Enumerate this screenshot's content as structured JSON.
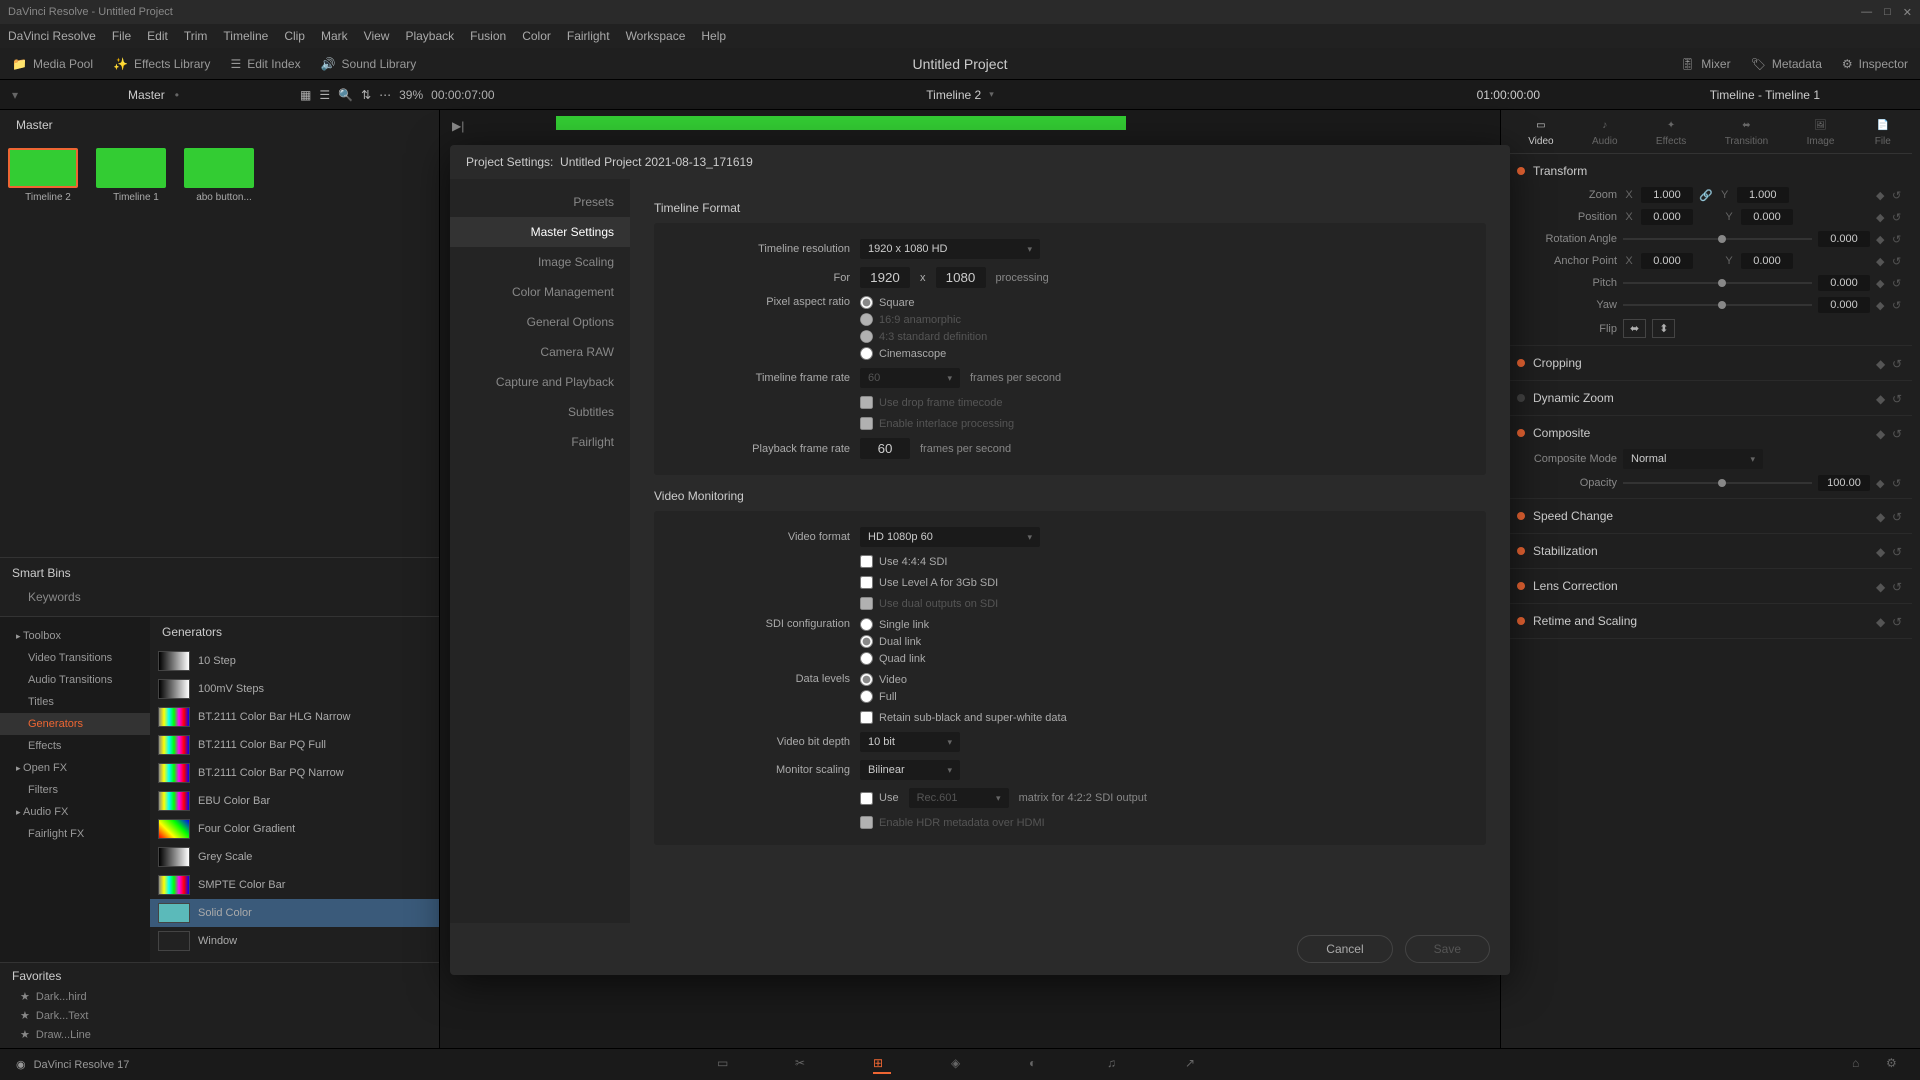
{
  "titlebar": {
    "title": "DaVinci Resolve - Untitled Project"
  },
  "menubar": [
    "DaVinci Resolve",
    "File",
    "Edit",
    "Trim",
    "Timeline",
    "Clip",
    "Mark",
    "View",
    "Playback",
    "Fusion",
    "Color",
    "Fairlight",
    "Workspace",
    "Help"
  ],
  "toolbar": {
    "media_pool": "Media Pool",
    "effects_library": "Effects Library",
    "edit_index": "Edit Index",
    "sound_library": "Sound Library",
    "project_title": "Untitled Project",
    "mixer": "Mixer",
    "metadata": "Metadata",
    "inspector": "Inspector"
  },
  "secondary": {
    "master": "Master",
    "zoom_pct": "39%",
    "timecode_left": "00:00:07:00",
    "timeline_name": "Timeline 2",
    "timecode_right": "01:00:00:00",
    "timeline_label": "Timeline - Timeline 1"
  },
  "left": {
    "master_tab": "Master",
    "clips": [
      {
        "label": "Timeline 2",
        "selected": true
      },
      {
        "label": "Timeline 1",
        "selected": false
      },
      {
        "label": "abo button...",
        "selected": false
      }
    ],
    "smart_bins": {
      "header": "Smart Bins",
      "items": [
        "Keywords"
      ]
    },
    "toolbox": {
      "items": [
        {
          "label": "Toolbox",
          "expandable": true
        },
        {
          "label": "Video Transitions",
          "child": true
        },
        {
          "label": "Audio Transitions",
          "child": true
        },
        {
          "label": "Titles",
          "child": true
        },
        {
          "label": "Generators",
          "child": true,
          "selected": true
        },
        {
          "label": "Effects",
          "child": true
        },
        {
          "label": "Open FX",
          "expandable": true
        },
        {
          "label": "Filters",
          "child": true
        },
        {
          "label": "Audio FX",
          "expandable": true
        },
        {
          "label": "Fairlight FX",
          "child": true
        }
      ]
    },
    "generators": {
      "header": "Generators",
      "items": [
        {
          "name": "10 Step",
          "swatch": "linear-gradient(90deg,#000,#fff)"
        },
        {
          "name": "100mV Steps",
          "swatch": "linear-gradient(90deg,#000,#fff)"
        },
        {
          "name": "BT.2111 Color Bar HLG Narrow",
          "swatch": "linear-gradient(90deg,#888,#ff0,#0ff,#0f0,#f0f,#f00,#00f)"
        },
        {
          "name": "BT.2111 Color Bar PQ Full",
          "swatch": "linear-gradient(90deg,#888,#ff0,#0ff,#0f0,#f0f,#f00,#00f)"
        },
        {
          "name": "BT.2111 Color Bar PQ Narrow",
          "swatch": "linear-gradient(90deg,#888,#ff0,#0ff,#0f0,#f0f,#f00,#00f)"
        },
        {
          "name": "EBU Color Bar",
          "swatch": "linear-gradient(90deg,#888,#ff0,#0ff,#0f0,#f0f,#f00,#00f)"
        },
        {
          "name": "Four Color Gradient",
          "swatch": "linear-gradient(45deg,#f00,#ff0,#0f0,#00f)"
        },
        {
          "name": "Grey Scale",
          "swatch": "linear-gradient(90deg,#000,#fff)"
        },
        {
          "name": "SMPTE Color Bar",
          "swatch": "linear-gradient(90deg,#888,#ff0,#0ff,#0f0,#f0f,#f00,#00f)"
        },
        {
          "name": "Solid Color",
          "swatch": "#5bbaba",
          "selected": true
        },
        {
          "name": "Window",
          "swatch": "#222"
        }
      ]
    },
    "favorites": {
      "header": "Favorites",
      "items": [
        "Dark...hird",
        "Dark...Text",
        "Draw...Line"
      ]
    }
  },
  "inspector": {
    "tabs": [
      "Video",
      "Audio",
      "Effects",
      "Transition",
      "Image",
      "File"
    ],
    "active_tab": "Video",
    "transform": {
      "title": "Transform",
      "zoom": {
        "label": "Zoom",
        "x": "1.000",
        "y": "1.000"
      },
      "position": {
        "label": "Position",
        "x": "0.000",
        "y": "0.000"
      },
      "rotation": {
        "label": "Rotation Angle",
        "value": "0.000"
      },
      "anchor": {
        "label": "Anchor Point",
        "x": "0.000",
        "y": "0.000"
      },
      "pitch": {
        "label": "Pitch",
        "value": "0.000"
      },
      "yaw": {
        "label": "Yaw",
        "value": "0.000"
      },
      "flip": {
        "label": "Flip"
      }
    },
    "sections": [
      {
        "title": "Cropping",
        "on": true
      },
      {
        "title": "Dynamic Zoom",
        "on": false
      },
      {
        "title": "Composite",
        "on": true,
        "mode_label": "Composite Mode",
        "mode": "Normal",
        "opacity_label": "Opacity",
        "opacity": "100.00"
      },
      {
        "title": "Speed Change",
        "on": true
      },
      {
        "title": "Stabilization",
        "on": true
      },
      {
        "title": "Lens Correction",
        "on": true
      },
      {
        "title": "Retime and Scaling",
        "on": true
      }
    ]
  },
  "dialog": {
    "title_prefix": "Project Settings:",
    "title_name": "Untitled Project 2021-08-13_171619",
    "sidebar": [
      "Presets",
      "Master Settings",
      "Image Scaling",
      "Color Management",
      "General Options",
      "Camera RAW",
      "Capture and Playback",
      "Subtitles",
      "Fairlight"
    ],
    "active_sidebar": "Master Settings",
    "timeline_format": {
      "header": "Timeline Format",
      "resolution_label": "Timeline resolution",
      "resolution": "1920 x 1080 HD",
      "for_label": "For",
      "width": "1920",
      "x": "x",
      "height": "1080",
      "processing": "processing",
      "par_label": "Pixel aspect ratio",
      "par_options": [
        {
          "label": "Square",
          "checked": true
        },
        {
          "label": "16:9 anamorphic",
          "disabled": true
        },
        {
          "label": "4:3 standard definition",
          "disabled": true
        },
        {
          "label": "Cinemascope"
        }
      ],
      "framerate_label": "Timeline frame rate",
      "framerate": "60",
      "fps_suffix": "frames per second",
      "drop_frame": "Use drop frame timecode",
      "interlace": "Enable interlace processing",
      "playback_label": "Playback frame rate",
      "playback_rate": "60"
    },
    "video_monitoring": {
      "header": "Video Monitoring",
      "format_label": "Video format",
      "format": "HD 1080p 60",
      "use_444": "Use 4:4:4 SDI",
      "level_a": "Use Level A for 3Gb SDI",
      "dual_out": "Use dual outputs on SDI",
      "sdi_label": "SDI configuration",
      "sdi_options": [
        {
          "label": "Single link"
        },
        {
          "label": "Dual link",
          "checked": true
        },
        {
          "label": "Quad link"
        }
      ],
      "data_label": "Data levels",
      "data_options": [
        {
          "label": "Video",
          "checked": true
        },
        {
          "label": "Full"
        }
      ],
      "retain": "Retain sub-black and super-white data",
      "bitdepth_label": "Video bit depth",
      "bitdepth": "10 bit",
      "scaling_label": "Monitor scaling",
      "scaling": "Bilinear",
      "use_matrix": "Use",
      "matrix_val": "Rec.601",
      "matrix_suffix": "matrix for 4:2:2 SDI output",
      "hdr": "Enable HDR metadata over HDMI"
    },
    "cancel": "Cancel",
    "save": "Save"
  },
  "footer": {
    "app": "DaVinci Resolve 17"
  }
}
